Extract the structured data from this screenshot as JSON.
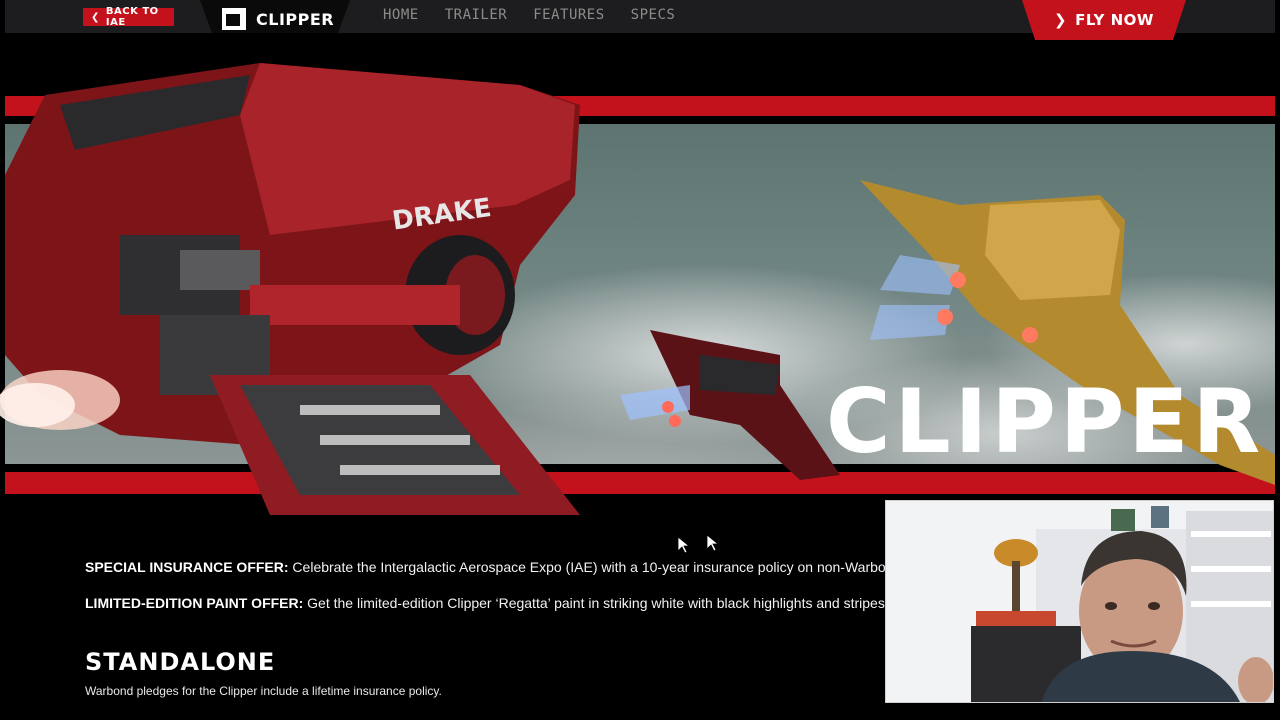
{
  "header": {
    "back_label": "BACK TO IAE",
    "brand_name": "CLIPPER",
    "nav": [
      "HOME",
      "TRAILER",
      "FEATURES",
      "SPECS"
    ],
    "cta_label": "FLY NOW"
  },
  "hero": {
    "ship_brand": "DRAKE",
    "title": "CLIPPER"
  },
  "offers": [
    {
      "label": "SPECIAL INSURANCE OFFER:",
      "text": " Celebrate the Intergalactic Aerospace Expo (IAE) with a 10-year insurance policy on non-Warbo"
    },
    {
      "label": "LIMITED-EDITION PAINT OFFER:",
      "text": " Get the limited-edition Clipper ‘Regatta’ paint in striking white with black highlights and stripes"
    }
  ],
  "section": {
    "title": "STANDALONE",
    "description": "Warbond pledges for the Clipper include a lifetime insurance policy."
  },
  "colors": {
    "accent": "#c4121d",
    "background": "#000000",
    "nav_bar": "#1d1d1f"
  },
  "icons": {
    "back": "chevron-left-icon",
    "cta": "chevron-right-icon",
    "brand": "clipper-logo-icon"
  }
}
